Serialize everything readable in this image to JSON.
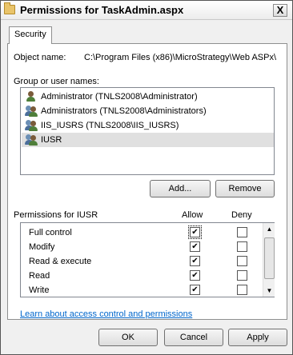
{
  "window": {
    "title": "Permissions for TaskAdmin.aspx",
    "close_label": "X"
  },
  "tabs": [
    {
      "label": "Security"
    }
  ],
  "object": {
    "label": "Object name:",
    "value": "C:\\Program Files (x86)\\MicroStrategy\\Web ASPx\\a"
  },
  "groups": {
    "label": "Group or user names:",
    "items": [
      {
        "label": "Administrator (TNLS2008\\Administrator)",
        "icon": "user-icon",
        "selected": false
      },
      {
        "label": "Administrators (TNLS2008\\Administrators)",
        "icon": "group-icon",
        "selected": false
      },
      {
        "label": "IIS_IUSRS (TNLS2008\\IIS_IUSRS)",
        "icon": "group-icon",
        "selected": false
      },
      {
        "label": "IUSR",
        "icon": "group-icon",
        "selected": true
      }
    ]
  },
  "buttons": {
    "add": "Add...",
    "remove": "Remove",
    "ok": "OK",
    "cancel": "Cancel",
    "apply": "Apply"
  },
  "permissions": {
    "label": "Permissions for IUSR",
    "allow_header": "Allow",
    "deny_header": "Deny",
    "rows": [
      {
        "name": "Full control",
        "allow": true,
        "deny": false
      },
      {
        "name": "Modify",
        "allow": true,
        "deny": false
      },
      {
        "name": "Read & execute",
        "allow": true,
        "deny": false
      },
      {
        "name": "Read",
        "allow": true,
        "deny": false
      },
      {
        "name": "Write",
        "allow": true,
        "deny": false
      }
    ]
  },
  "link": {
    "label": "Learn about access control and permissions"
  },
  "colors": {
    "link": "#0066cc",
    "selection": "#e0e0e0"
  }
}
